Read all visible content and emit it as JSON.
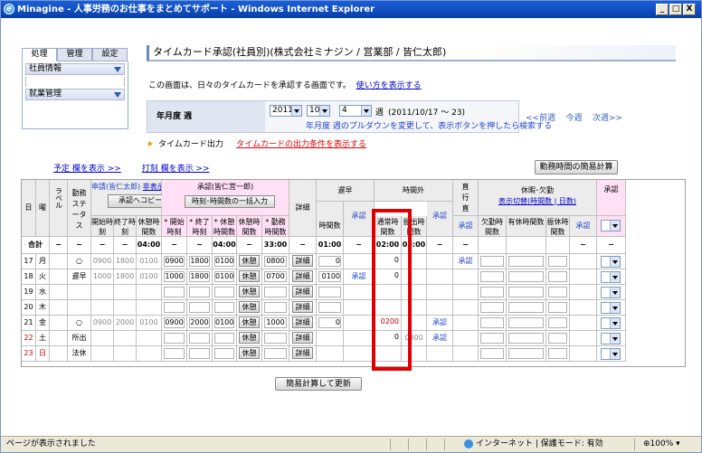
{
  "window": {
    "title": "Minagine - 人事労務のお仕事をまとめてサポート - Windows Internet Explorer",
    "controls": [
      "_",
      "□",
      "X"
    ]
  },
  "left": {
    "tabs": [
      "処理",
      "管理",
      "設定"
    ],
    "menus": [
      "社員情報",
      "就業管理"
    ]
  },
  "header": {
    "title": "タイムカード承認(社員別)(株式会社ミナジン / 営業部 / 皆仁太郎)",
    "description": "この画面は、日々のタイムカードを承認する画面です。",
    "howto_link": "使い方を表示する"
  },
  "period": {
    "label": "年月度 週",
    "year": "2011",
    "month": "10",
    "week": "4",
    "week_suffix": "週",
    "range": "(2011/10/17 〜 23)",
    "hint": "年月度 週のプルダウンを変更して、表示ボタンを押したら検索する",
    "prev": "<<前週",
    "this": "今週",
    "next": "次週>>"
  },
  "output": {
    "label": "タイムカード出力",
    "condition_link": "タイムカードの出力条件を表示する"
  },
  "display_links": {
    "yotei": "予定 欄を表示 >>",
    "dakoku": "打刻 欄を表示 >>"
  },
  "calc_button": "勤務時間の簡易計算",
  "table": {
    "h_day": "日",
    "h_dow": "曜",
    "h_label": "ラベル",
    "h_status": "勤務ステータス",
    "h_apply": "申請(皆仁太郎)",
    "h_apply_hide": "非表示",
    "h_copy": "承認へコピー",
    "h_approve": "承認(皆仁営一郎)",
    "h_bulk": "時刻･時間数の一括入力",
    "h_start": "開始時刻",
    "h_end": "終了時刻",
    "h_break": "休憩時間数",
    "h_a_start": "* 開始時刻",
    "h_a_end": "* 終了時刻",
    "h_a_break": "* 休憩時間数",
    "h_a_break2": "休憩時間数",
    "h_a_work": "* 勤務時間数",
    "h_detail": "詳細",
    "h_late": "遅早",
    "h_late_hours": "時間数",
    "h_late_appr": "承認",
    "h_ot": "時間外",
    "h_ot_normal": "通常時間数",
    "h_ot_transfer": "振出時間数",
    "h_ot_appr": "承認",
    "h_direct": "直行直帰出張",
    "h_direct_appr": "承認",
    "h_leave": "休暇･欠勤",
    "h_leave_toggle": "表示切替(時間数 | 日数)",
    "h_absent": "欠勤時間数",
    "h_paid": "有休時間数",
    "h_sub": "振休時間数",
    "h_leave_appr": "承認",
    "h_final": "承認",
    "total": {
      "label": "合計",
      "dash": "−",
      "break": "04:00",
      "a_break": "04:00",
      "a_work": "33:00",
      "late": "01:00",
      "ot_normal": "02:00",
      "ot_transfer": "08:00"
    },
    "btn_break": "休憩",
    "btn_detail": "詳細",
    "rows": [
      {
        "day": "17",
        "dow": "月",
        "status": "○",
        "start": "0900",
        "end": "1800",
        "brk": "0100",
        "a_start": "0900",
        "a_end": "1800",
        "a_brk": "0100",
        "a_work": "0800",
        "late": "0",
        "ot": "0",
        "direct": "承認",
        "late_appr": "",
        "ot_transfer": "",
        "ot_appr": ""
      },
      {
        "day": "18",
        "dow": "火",
        "status": "遅早",
        "start": "1000",
        "end": "1800",
        "brk": "0100",
        "a_start": "1000",
        "a_end": "1800",
        "a_brk": "0100",
        "a_work": "0700",
        "late": "0100",
        "ot": "0",
        "direct": "",
        "late_appr": "承認",
        "ot_transfer": "",
        "ot_appr": ""
      },
      {
        "day": "19",
        "dow": "水",
        "status": "",
        "start": "",
        "end": "",
        "brk": "",
        "a_start": "",
        "a_end": "",
        "a_brk": "",
        "a_work": "",
        "late": "",
        "ot": "",
        "direct": "",
        "late_appr": "",
        "ot_transfer": "",
        "ot_appr": ""
      },
      {
        "day": "20",
        "dow": "木",
        "status": "",
        "start": "",
        "end": "",
        "brk": "",
        "a_start": "",
        "a_end": "",
        "a_brk": "",
        "a_work": "",
        "late": "",
        "ot": "",
        "direct": "",
        "late_appr": "",
        "ot_transfer": "",
        "ot_appr": ""
      },
      {
        "day": "21",
        "dow": "金",
        "status": "○",
        "start": "0900",
        "end": "2000",
        "brk": "0100",
        "a_start": "0900",
        "a_end": "2000",
        "a_brk": "0100",
        "a_work": "1000",
        "late": "0",
        "ot": "0200",
        "direct": "",
        "late_appr": "",
        "ot_transfer": "",
        "ot_appr": "承認"
      },
      {
        "day": "22",
        "dow": "土",
        "status": "所出",
        "start": "",
        "end": "",
        "brk": "",
        "a_start": "",
        "a_end": "",
        "a_brk": "",
        "a_work": "",
        "late": "",
        "ot": "0",
        "direct": "",
        "late_appr": "",
        "ot_transfer": "0800",
        "ot_appr": "承認"
      },
      {
        "day": "23",
        "dow": "日",
        "status": "法休",
        "start": "",
        "end": "",
        "brk": "",
        "a_start": "",
        "a_end": "",
        "a_brk": "",
        "a_work": "",
        "late": "",
        "ot": "",
        "direct": "",
        "late_appr": "",
        "ot_transfer": "",
        "ot_appr": ""
      }
    ]
  },
  "update_button": "簡易計算して更新",
  "status": {
    "left": "ページが表示されました",
    "zone": "インターネット | 保護モード: 有効",
    "zoom": "100%"
  }
}
